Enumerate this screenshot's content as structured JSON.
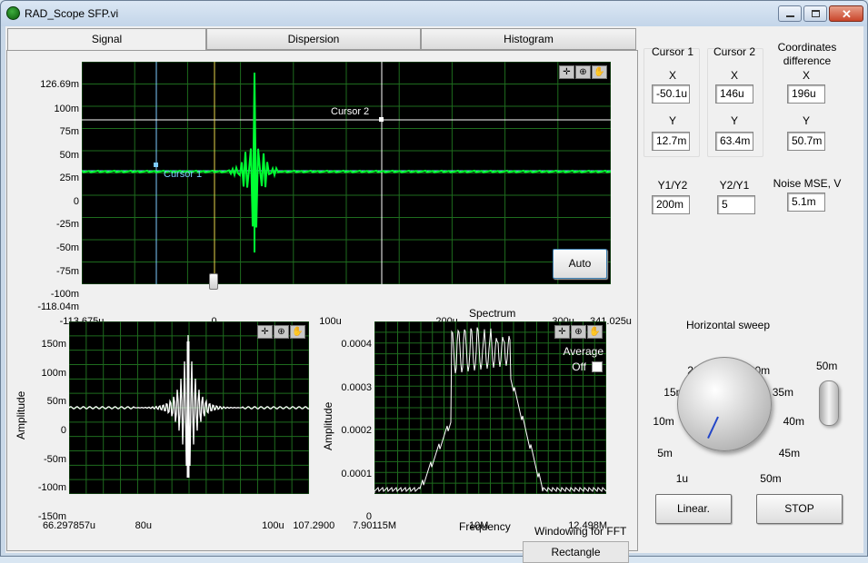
{
  "window": {
    "title": "RAD_Scope SFP.vi"
  },
  "tabs": [
    "Signal",
    "Dispersion",
    "Histogram"
  ],
  "signal_graph": {
    "y_ticks": [
      "126.69m",
      "100m",
      "75m",
      "50m",
      "25m",
      "0",
      "-25m",
      "-50m",
      "-75m",
      "-100m",
      "-118.04m"
    ],
    "x_ticks": [
      "-113.675u",
      "0",
      "100u",
      "200u",
      "300u",
      "341.025u"
    ],
    "cursor1_label": "Cursor 1",
    "cursor2_label": "Cursor 2",
    "auto_button": "Auto",
    "colors": {
      "trace": "#00ff33",
      "grid": "#1e6b1e",
      "cursor1": "#7ecbff",
      "cursor2": "#ffffff",
      "marker": "#e6d44a"
    }
  },
  "time_graph": {
    "y_label": "Amplitude",
    "y_ticks": [
      "150m",
      "100m",
      "50m",
      "0",
      "-50m",
      "-100m",
      "-150m"
    ],
    "x_ticks": [
      "66.297857u",
      "80u",
      "100u",
      "107.2900"
    ],
    "colors": {
      "trace": "#ffffff",
      "grid": "#1e6b1e"
    }
  },
  "spectrum_graph": {
    "title": "Spectrum",
    "y_label": "Amplitude",
    "x_label": "Frequency",
    "y_ticks": [
      "0.0004",
      "0.0003",
      "0.0002",
      "0.0001",
      "0"
    ],
    "x_ticks": [
      "7.90115M",
      "10M",
      "12.498M"
    ],
    "average_label": "Average",
    "average_value": "Off"
  },
  "windowing": {
    "label": "Windowing for FFT",
    "value": "Rectangle"
  },
  "cursor_panel": {
    "cursor1": {
      "title": "Cursor 1",
      "x_label": "X",
      "x": "-50.1u",
      "y_label": "Y",
      "y": "12.7m"
    },
    "cursor2": {
      "title": "Cursor 2",
      "x_label": "X",
      "x": "146u",
      "y_label": "Y",
      "y": "63.4m"
    },
    "diff": {
      "title": "Coordinates difference",
      "x_label": "X",
      "x": "196u",
      "y_label": "Y",
      "y": "50.7m"
    },
    "y1y2": {
      "label": "Y1/Y2",
      "value": "200m"
    },
    "y2y1": {
      "label": "Y2/Y1",
      "value": "5"
    },
    "noise": {
      "label": "Noise MSE, V",
      "value": "5.1m"
    }
  },
  "sweep": {
    "label": "Horizontal sweep",
    "knob_ticks": [
      "1u",
      "5m",
      "10m",
      "15m",
      "20m",
      "25m",
      "30m",
      "35m",
      "40m",
      "45m",
      "50m"
    ],
    "switch_label": "50m"
  },
  "buttons": {
    "linear": "Linear.",
    "stop": "STOP"
  }
}
